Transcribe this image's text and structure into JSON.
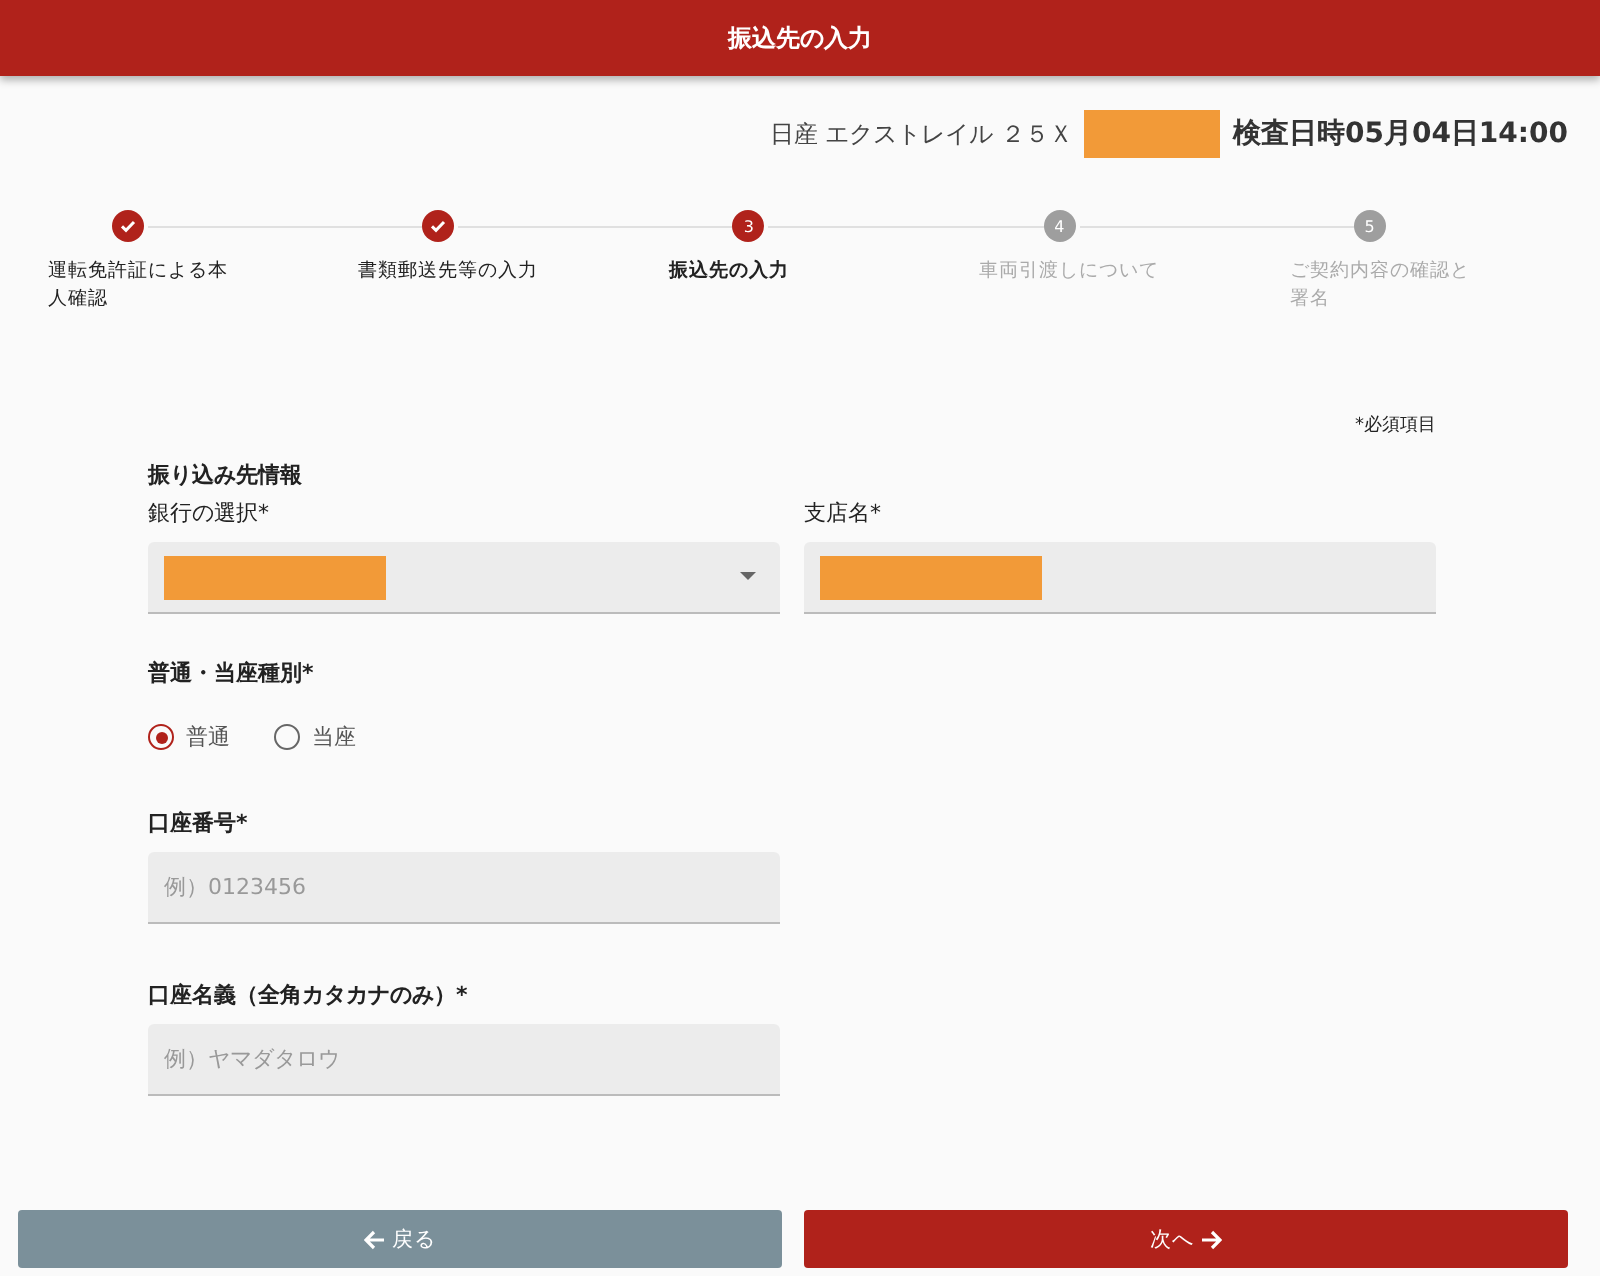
{
  "header": {
    "title": "振込先の入力"
  },
  "vehicle": {
    "name": "日産 エクストレイル ２５Ｘ",
    "inspection": "検査日時05月04日14:00"
  },
  "steps": [
    {
      "label": "運転免許証による本人確認",
      "completed": true,
      "selected": false
    },
    {
      "label": "書類郵送先等の入力",
      "completed": true,
      "selected": false
    },
    {
      "label": "振込先の入力",
      "completed": false,
      "selected": true,
      "number": "3"
    },
    {
      "label": "車両引渡しについて",
      "completed": false,
      "selected": false,
      "number": "4"
    },
    {
      "label": "ご契約内容の確認と署名",
      "completed": false,
      "selected": false,
      "number": "5"
    }
  ],
  "required_note": "*必須項目",
  "section_title": "振り込み先情報",
  "bank_fields": [
    {
      "label": "銀行の選択*",
      "kind": "select"
    },
    {
      "label": "支店名*",
      "kind": "text"
    }
  ],
  "account_type": {
    "label": "普通・当座種別*",
    "options": [
      {
        "label": "普通",
        "selected": true
      },
      {
        "label": "当座",
        "selected": false
      }
    ]
  },
  "account_fields": [
    {
      "label": "口座番号*",
      "placeholder": "例）0123456"
    },
    {
      "label": "口座名義（全角カタカナのみ）*",
      "placeholder": "例）ヤマダタロウ"
    }
  ],
  "buttons": [
    {
      "label": "戻る",
      "kind": "back"
    },
    {
      "label": "次へ",
      "kind": "next"
    }
  ]
}
